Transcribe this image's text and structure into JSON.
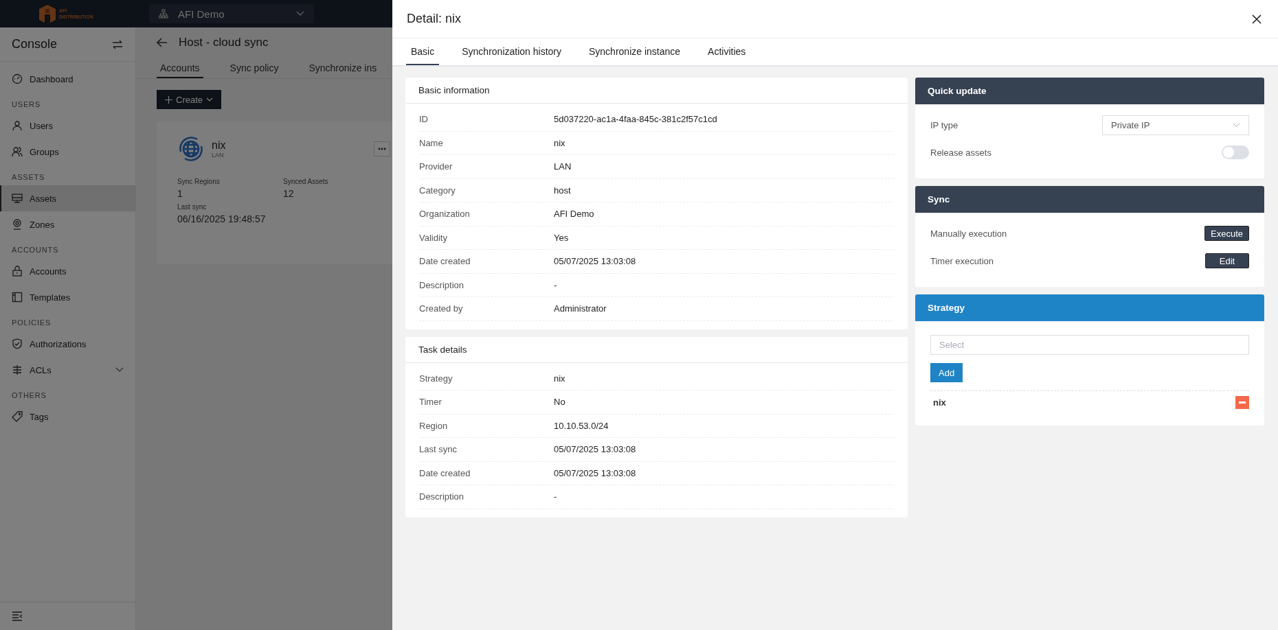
{
  "header": {
    "logo_text": [
      "AFI",
      "DISTRIBUTION"
    ],
    "org_selector": "AFI Demo"
  },
  "sidebar": {
    "title": "Console",
    "sections": [
      {
        "items": [
          {
            "kind": "link",
            "label": "Dashboard",
            "selected": false
          }
        ]
      },
      {
        "heading": "USERS",
        "items": [
          {
            "kind": "link",
            "label": "Users",
            "selected": false
          },
          {
            "kind": "link",
            "label": "Groups",
            "selected": false
          }
        ]
      },
      {
        "heading": "ASSETS",
        "items": [
          {
            "kind": "link",
            "label": "Assets",
            "selected": true
          },
          {
            "kind": "link",
            "label": "Zones",
            "selected": false
          }
        ]
      },
      {
        "heading": "ACCOUNTS",
        "items": [
          {
            "kind": "link",
            "label": "Accounts",
            "selected": false
          },
          {
            "kind": "link",
            "label": "Templates",
            "selected": false
          }
        ]
      },
      {
        "heading": "POLICIES",
        "items": [
          {
            "kind": "link",
            "label": "Authorizations",
            "selected": false
          },
          {
            "kind": "group",
            "label": "ACLs",
            "selected": false
          }
        ]
      },
      {
        "heading": "OTHERS",
        "items": [
          {
            "kind": "link",
            "label": "Tags",
            "selected": false
          }
        ]
      }
    ]
  },
  "page": {
    "title": "Host - cloud sync",
    "tabs": [
      {
        "label": "Accounts",
        "selected": true
      },
      {
        "label": "Sync policy",
        "selected": false
      },
      {
        "label": "Synchronize ins",
        "selected": false
      }
    ],
    "create_button": "Create",
    "card": {
      "name": "nix",
      "subtitle": "LAN",
      "stats": [
        {
          "label": "Sync Regions",
          "value": "1"
        },
        {
          "label": "Synced Assets",
          "value": "12"
        },
        {
          "label": "Last sync",
          "value": "06/16/2025 19:48:57"
        }
      ]
    }
  },
  "drawer": {
    "title": "Detail: nix",
    "tabs": [
      {
        "label": "Basic",
        "selected": true
      },
      {
        "label": "Synchronization history",
        "selected": false
      },
      {
        "label": "Synchronize instance",
        "selected": false
      },
      {
        "label": "Activities",
        "selected": false
      }
    ],
    "basic_info": {
      "title": "Basic information",
      "rows": [
        {
          "label": "ID",
          "value": "5d037220-ac1a-4faa-845c-381c2f57c1cd"
        },
        {
          "label": "Name",
          "value": "nix"
        },
        {
          "label": "Provider",
          "value": "LAN"
        },
        {
          "label": "Category",
          "value": "host"
        },
        {
          "label": "Organization",
          "value": "AFI Demo"
        },
        {
          "label": "Validity",
          "value": "Yes"
        },
        {
          "label": "Date created",
          "value": "05/07/2025 13:03:08"
        },
        {
          "label": "Description",
          "value": "-"
        },
        {
          "label": "Created by",
          "value": "Administrator"
        }
      ]
    },
    "task_details": {
      "title": "Task details",
      "rows": [
        {
          "label": "Strategy",
          "value": "nix"
        },
        {
          "label": "Timer",
          "value": "No"
        },
        {
          "label": "Region",
          "value": "10.10.53.0/24"
        },
        {
          "label": "Last sync",
          "value": "05/07/2025 13:03:08"
        },
        {
          "label": "Date created",
          "value": "05/07/2025 13:03:08"
        },
        {
          "label": "Description",
          "value": "-"
        }
      ]
    },
    "quick_update": {
      "title": "Quick update",
      "ip_type": {
        "label": "IP type",
        "value": "Private IP"
      },
      "release_assets": {
        "label": "Release assets",
        "on": false
      }
    },
    "sync": {
      "title": "Sync",
      "rows": [
        {
          "label": "Manually execution",
          "button": "Execute"
        },
        {
          "label": "Timer execution",
          "button": "Edit"
        }
      ]
    },
    "strategy": {
      "title": "Strategy",
      "placeholder": "Select",
      "add_button": "Add",
      "items": [
        {
          "name": "nix"
        }
      ]
    }
  }
}
